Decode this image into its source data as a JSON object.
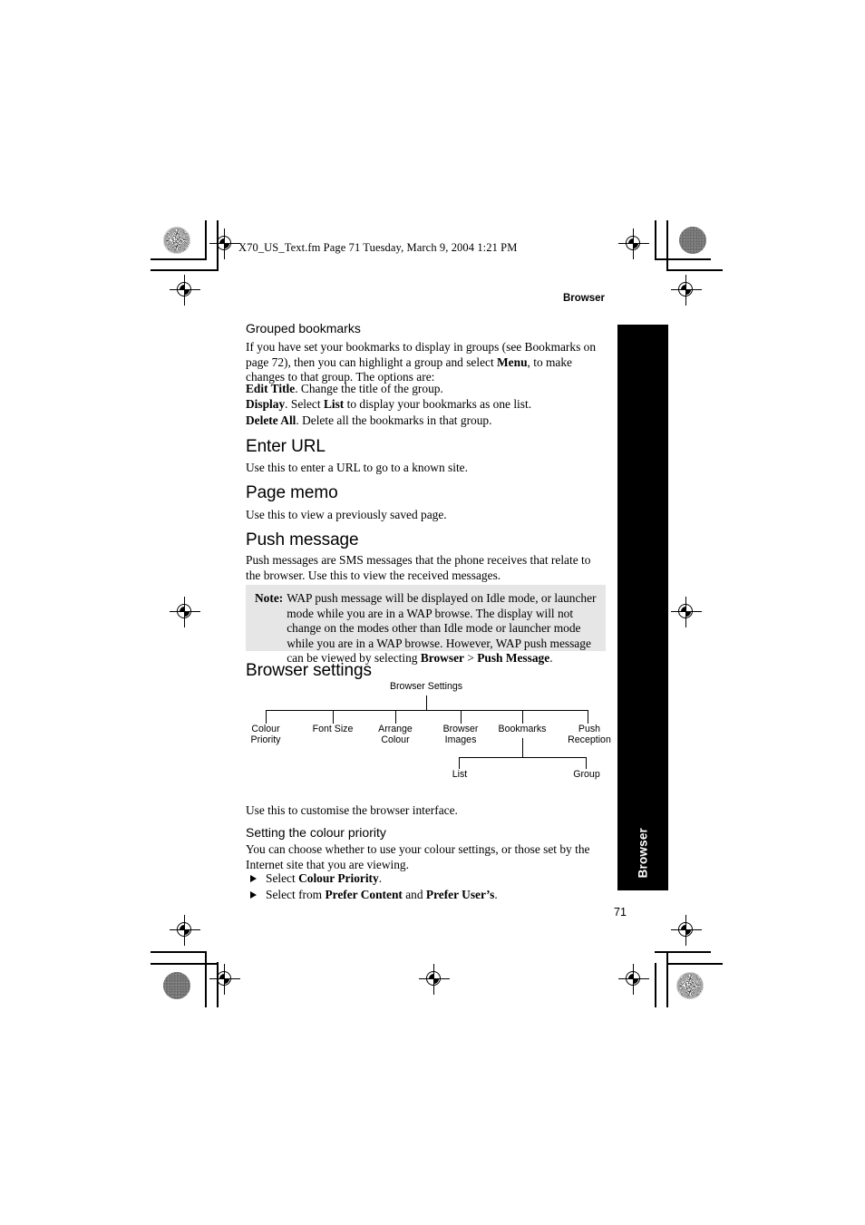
{
  "page": {
    "file_stamp": "X70_US_Text.fm  Page 71  Tuesday, March 9, 2004  1:21 PM",
    "running_head": "Browser",
    "folio": "71",
    "thumb_tab_label": "Browser"
  },
  "content": {
    "grouped_bookmarks": {
      "heading": "Grouped bookmarks",
      "intro_1": "If you have set your bookmarks to display in groups (see Bookmarks on page 72), then you can highlight a group and select ",
      "intro_bold": "Menu",
      "intro_2": ", to make changes to that group. The options are:",
      "items": [
        {
          "term": "Edit Title",
          "rest": ". Change the title of the group."
        },
        {
          "term": "Display",
          "rest_a": ". Select ",
          "emph": "List",
          "rest_b": " to display your bookmarks as one list."
        },
        {
          "term": "Delete All",
          "rest": ". Delete all the bookmarks in that group."
        }
      ]
    },
    "enter_url": {
      "heading": "Enter URL",
      "body": "Use this to enter a URL to go to a known site."
    },
    "page_memo": {
      "heading": "Page memo",
      "body": "Use this to view a previously saved page."
    },
    "push_message": {
      "heading": "Push message",
      "body": "Push messages are SMS messages that the phone receives that relate to the browser. Use this to view the received messages."
    },
    "note": {
      "label": "Note:",
      "text_1": "WAP push message will be displayed on Idle mode, or launcher mode while you are in a WAP browse. The display will not change on the modes other than Idle mode or launcher mode while you are in a WAP browse. However, WAP push message can be viewed by selecting ",
      "bold_1": "Browser",
      "text_2": " > ",
      "bold_2": "Push Message",
      "text_3": "."
    },
    "browser_settings": {
      "heading": "Browser settings",
      "body": "Use this to customise the browser interface."
    },
    "colour_priority": {
      "heading": "Setting the colour priority",
      "body": "You can choose whether to use your colour settings, or those set by the Internet site that you are viewing.",
      "bullets": [
        {
          "lead": "Select ",
          "bold_1": "Colour Priority",
          "tail": "."
        },
        {
          "lead": "Select from ",
          "bold_1": "Prefer Content",
          "mid": " and ",
          "bold_2": "Prefer User’s",
          "tail": "."
        }
      ]
    }
  },
  "chart_data": {
    "type": "diagram",
    "title": "Browser Settings",
    "root": "Browser Settings",
    "children": [
      "Colour\nPriority",
      "Font Size",
      "Arrange\nColour",
      "Browser\nImages",
      "Bookmarks",
      "Push\nReception"
    ],
    "subtree": {
      "parent": "Bookmarks",
      "children": [
        "List",
        "Group"
      ]
    }
  },
  "colors": {
    "note_background": "#e6e6e6",
    "thumb_tab": "#000000",
    "text": "#000000",
    "rule": "#000000"
  }
}
